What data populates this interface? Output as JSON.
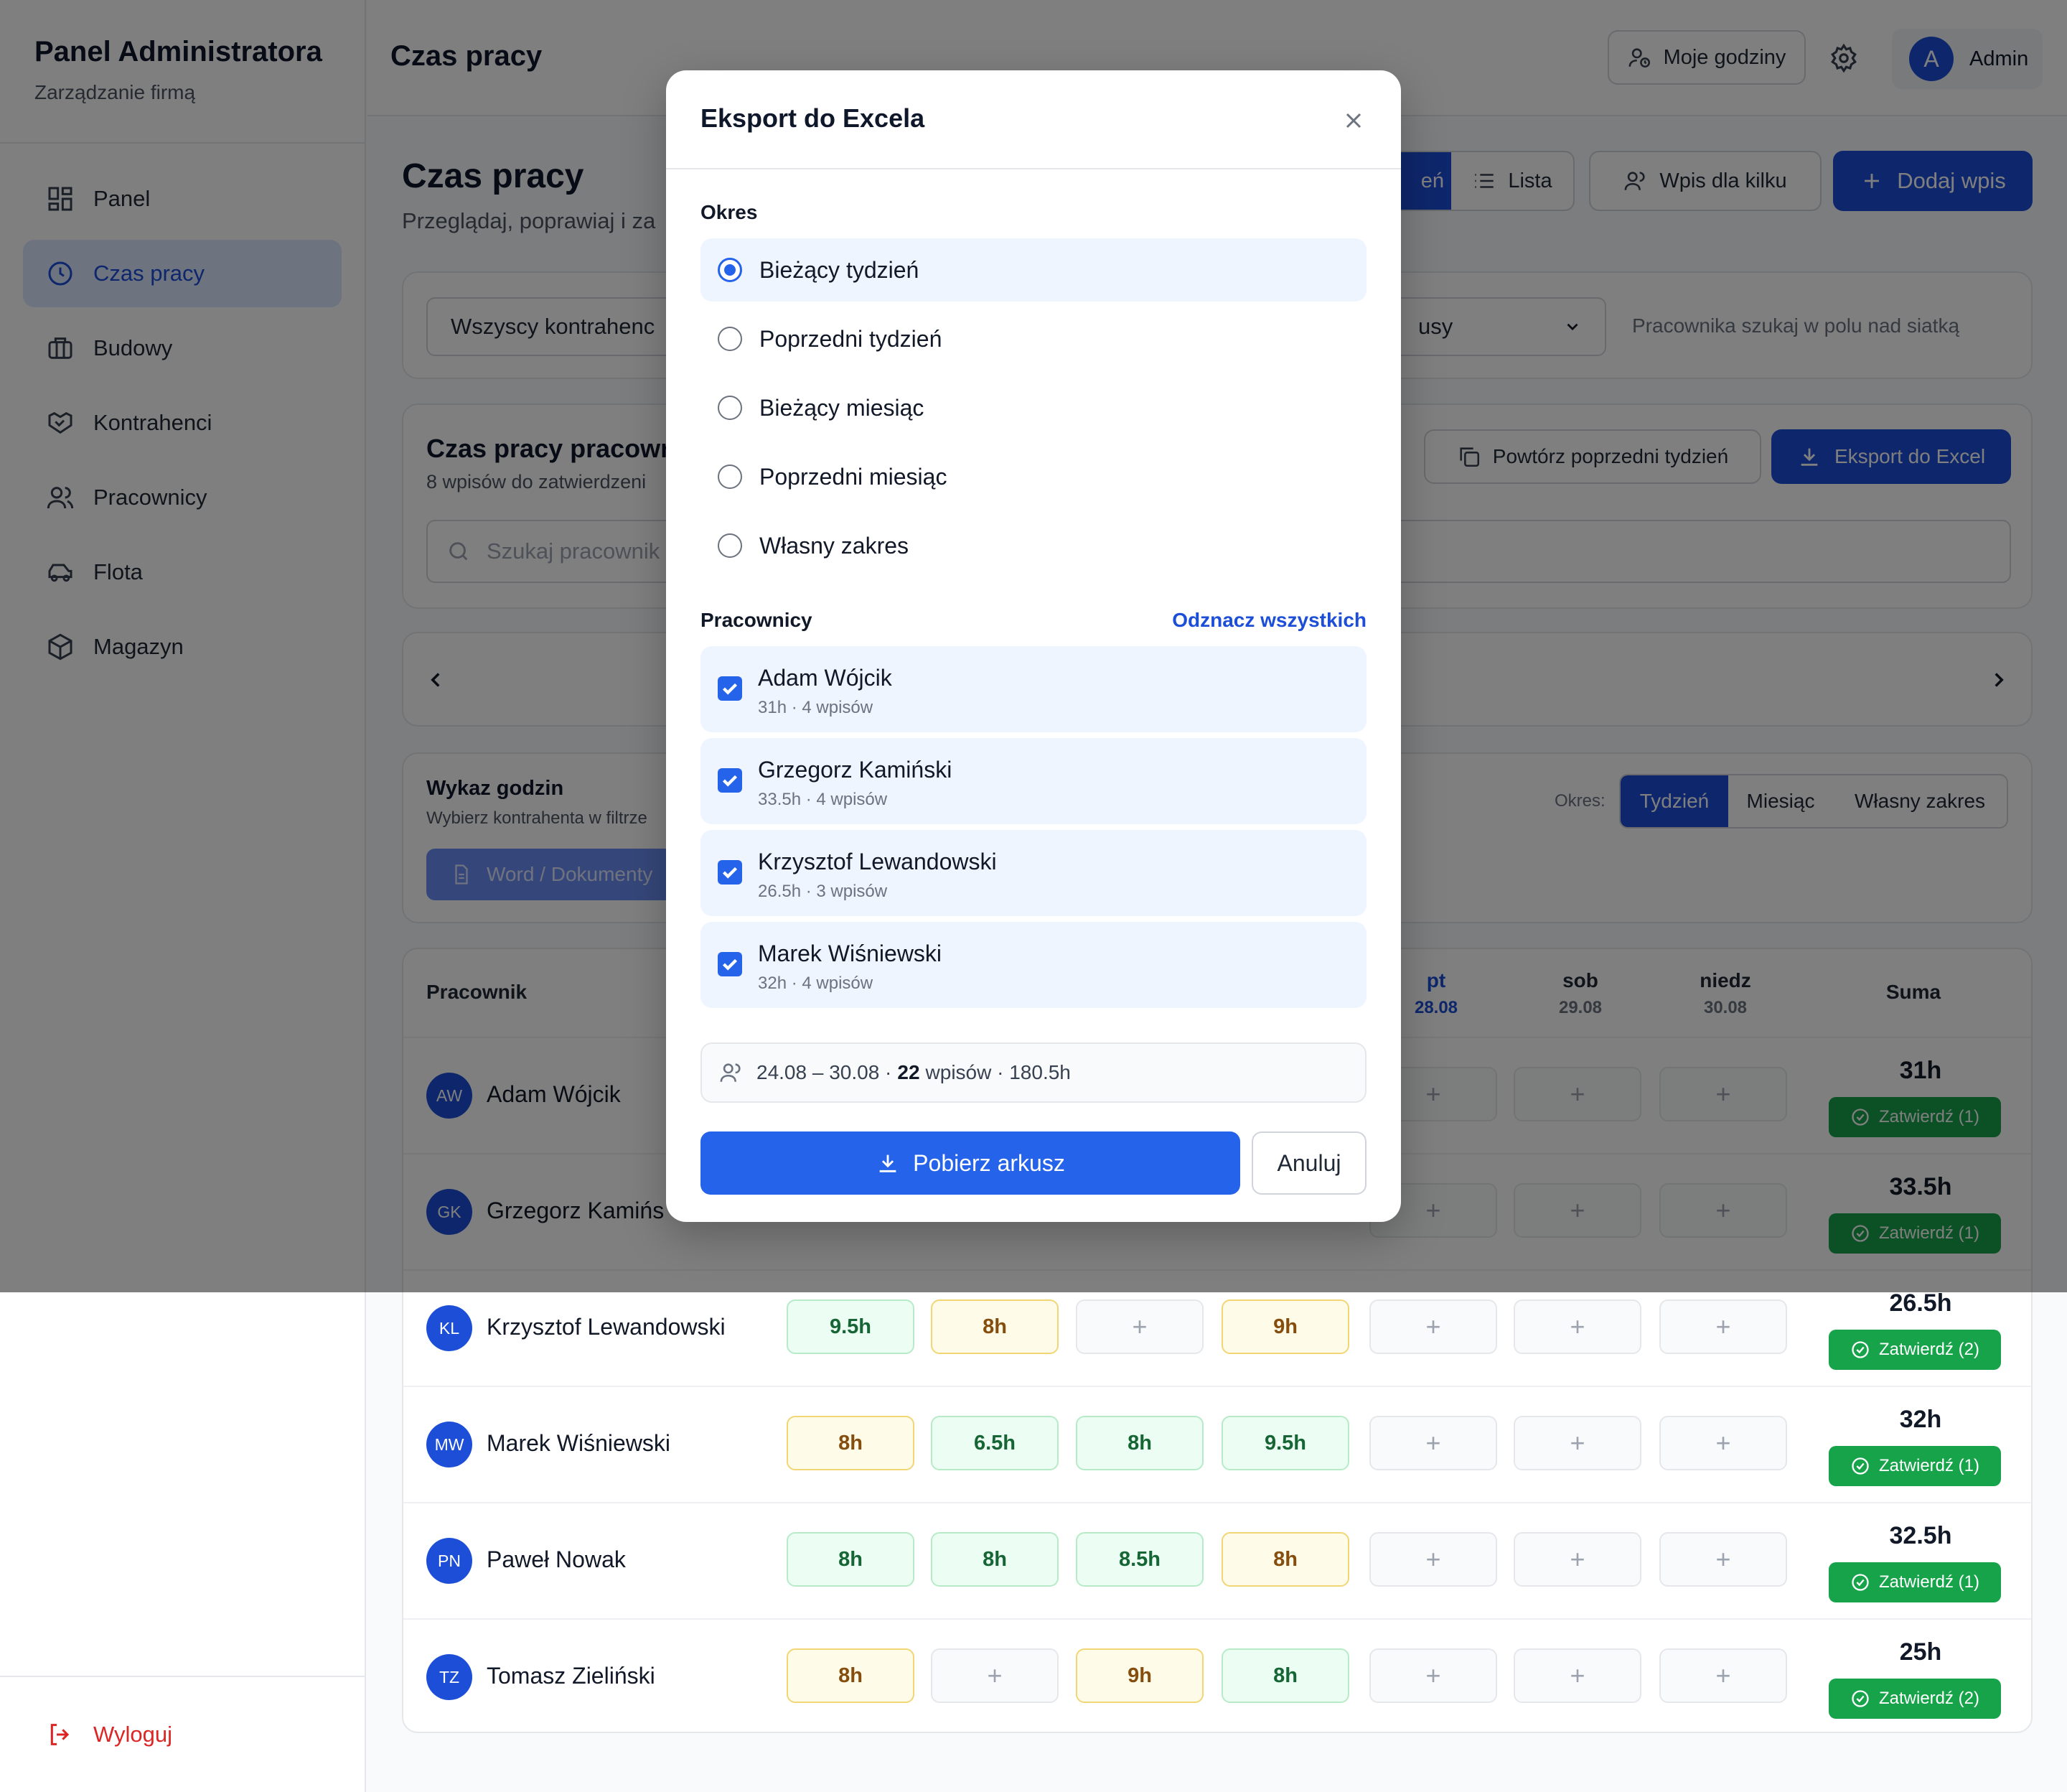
{
  "sidebar": {
    "brand_title": "Panel Administratora",
    "brand_sub": "Zarządzanie firmą",
    "items": [
      {
        "label": "Panel",
        "icon": "dashboard-icon"
      },
      {
        "label": "Czas pracy",
        "icon": "clock-icon",
        "active": true
      },
      {
        "label": "Budowy",
        "icon": "briefcase-icon"
      },
      {
        "label": "Kontrahenci",
        "icon": "handshake-icon"
      },
      {
        "label": "Pracownicy",
        "icon": "users-icon"
      },
      {
        "label": "Flota",
        "icon": "car-icon"
      },
      {
        "label": "Magazyn",
        "icon": "box-icon"
      }
    ],
    "logout": "Wyloguj"
  },
  "topbar": {
    "title": "Czas pracy",
    "my_hours": "Moje godziny",
    "admin_initial": "A",
    "admin_label": "Admin"
  },
  "main": {
    "title": "Czas pracy",
    "subtitle": "Przeglądaj, poprawiaj i za",
    "view_grid": "eń",
    "view_list": "Lista",
    "multi_entry": "Wpis dla kilku",
    "add_entry": "Dodaj wpis",
    "filter_contractor": "Wszyscy kontrahenc",
    "filter_status": "usy",
    "filter_hint": "Pracownika szukaj w polu nad siatką",
    "workers_title": "Czas pracy pracowr",
    "workers_sub": "8 wpisów do zatwierdzeni",
    "repeat_week": "Powtórz poprzedni tydzień",
    "export_excel": "Eksport do Excel",
    "search_placeholder": "Szukaj pracownik",
    "report_title": "Wykaz godzin",
    "report_sub": "Wybierz kontrahenta w filtrze",
    "word_docs": "Word / Dokumenty",
    "period_label": "Okres:",
    "period_options": [
      "Tydzień",
      "Miesiąc",
      "Własny zakres"
    ]
  },
  "table": {
    "col_employee": "Pracownik",
    "col_sum": "Suma",
    "days": [
      {
        "name": "pt",
        "date": "28.08"
      },
      {
        "name": "sob",
        "date": "29.08"
      },
      {
        "name": "niedz",
        "date": "30.08"
      }
    ],
    "rows": [
      {
        "initials": "AW",
        "name": "Adam Wójcik",
        "cells": [
          "",
          "",
          "",
          "",
          "+",
          "+",
          "+"
        ],
        "sum": "31h",
        "approve": "Zatwierdź (1)"
      },
      {
        "initials": "GK",
        "name": "Grzegorz Kamińs",
        "cells": [
          "",
          "",
          "",
          "",
          "+",
          "+",
          "+"
        ],
        "sum": "33.5h",
        "approve": "Zatwierdź (1)"
      },
      {
        "initials": "KL",
        "name": "Krzysztof Lewandowski",
        "cells": [
          "9.5h",
          "8h",
          "+",
          "9h",
          "+",
          "+",
          "+"
        ],
        "sum": "26.5h",
        "approve": "Zatwierdź (2)"
      },
      {
        "initials": "MW",
        "name": "Marek Wiśniewski",
        "cells": [
          "8h",
          "6.5h",
          "8h",
          "9.5h",
          "+",
          "+",
          "+"
        ],
        "sum": "32h",
        "approve": "Zatwierdź (1)"
      },
      {
        "initials": "PN",
        "name": "Paweł Nowak",
        "cells": [
          "8h",
          "8h",
          "8.5h",
          "8h",
          "+",
          "+",
          "+"
        ],
        "sum": "32.5h",
        "approve": "Zatwierdź (1)"
      },
      {
        "initials": "TZ",
        "name": "Tomasz Zieliński",
        "cells": [
          "8h",
          "+",
          "9h",
          "8h",
          "+",
          "+",
          "+"
        ],
        "sum": "25h",
        "approve": "Zatwierdź (2)"
      }
    ]
  },
  "modal": {
    "title": "Eksport do Excela",
    "period_label": "Okres",
    "period_options": [
      {
        "label": "Bieżący tydzień",
        "selected": true
      },
      {
        "label": "Poprzedni tydzień",
        "selected": false
      },
      {
        "label": "Bieżący miesiąc",
        "selected": false
      },
      {
        "label": "Poprzedni miesiąc",
        "selected": false
      },
      {
        "label": "Własny zakres",
        "selected": false
      }
    ],
    "employees_label": "Pracownicy",
    "deselect_all": "Odznacz wszystkich",
    "employees": [
      {
        "name": "Adam Wójcik",
        "meta": "31h · 4 wpisów",
        "checked": true
      },
      {
        "name": "Grzegorz Kamiński",
        "meta": "33.5h · 4 wpisów",
        "checked": true
      },
      {
        "name": "Krzysztof Lewandowski",
        "meta": "26.5h · 3 wpisów",
        "checked": true
      },
      {
        "name": "Marek Wiśniewski",
        "meta": "32h · 4 wpisów",
        "checked": true
      }
    ],
    "summary_range": "24.08 – 30.08 ·",
    "summary_count": "22",
    "summary_rest": "wpisów · 180.5h",
    "download": "Pobierz arkusz",
    "cancel": "Anuluj"
  },
  "colors": {
    "primary": "#1d4ed8",
    "primary_bright": "#2563eb",
    "success": "#16a34a",
    "danger": "#dc2626"
  }
}
